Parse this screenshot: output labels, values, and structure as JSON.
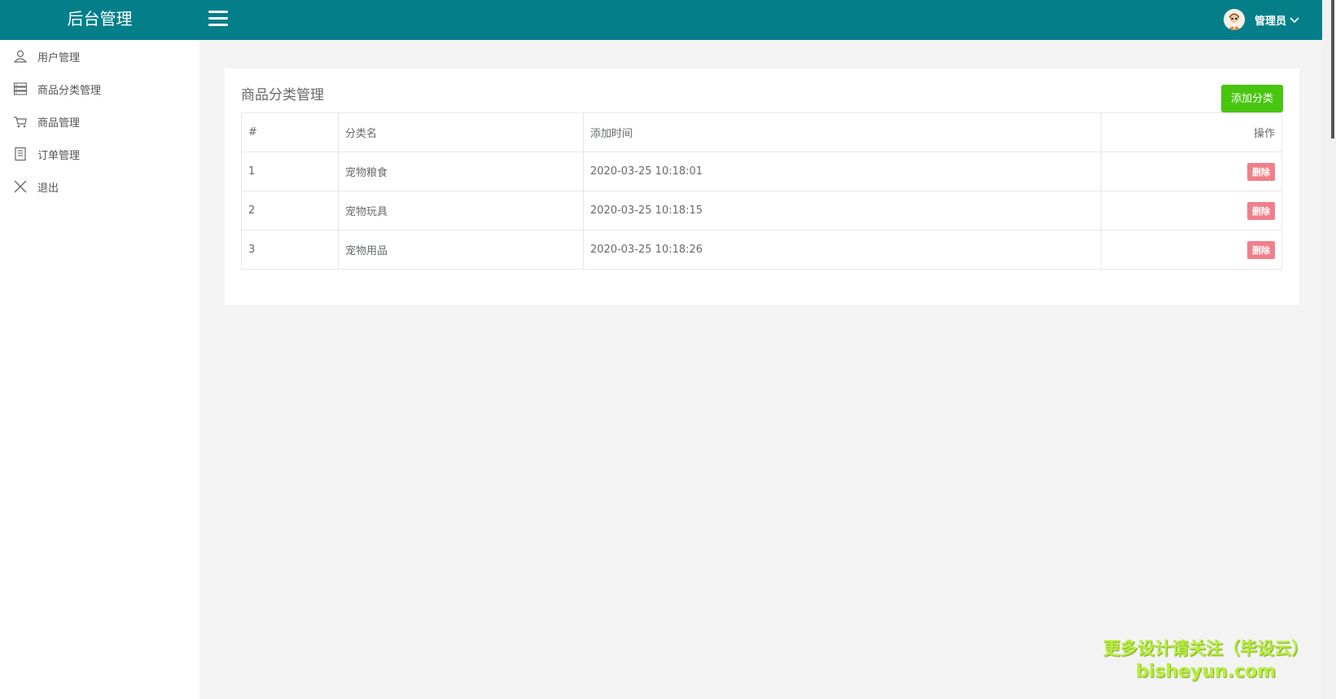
{
  "header": {
    "brand": "后台管理",
    "user_name": "管理员"
  },
  "sidebar": {
    "items": [
      {
        "label": "用户管理",
        "icon": "user-icon"
      },
      {
        "label": "商品分类管理",
        "icon": "list-icon"
      },
      {
        "label": "商品管理",
        "icon": "cart-icon"
      },
      {
        "label": "订单管理",
        "icon": "document-icon"
      },
      {
        "label": "退出",
        "icon": "close-icon"
      }
    ]
  },
  "main": {
    "title": "商品分类管理",
    "add_button": "添加分类",
    "table": {
      "headers": [
        "#",
        "分类名",
        "添加时间",
        "操作"
      ],
      "rows": [
        {
          "idx": "1",
          "name": "宠物粮食",
          "time": "2020-03-25 10:18:01",
          "action": "删除"
        },
        {
          "idx": "2",
          "name": "宠物玩具",
          "time": "2020-03-25 10:18:15",
          "action": "删除"
        },
        {
          "idx": "3",
          "name": "宠物用品",
          "time": "2020-03-25 10:18:26",
          "action": "删除"
        }
      ]
    }
  },
  "watermark": {
    "line1": "更多设计请关注（毕设云）",
    "line2": "bisheyun.com"
  },
  "colors": {
    "header_bg": "#047f8a",
    "add_button_bg": "#48c60f",
    "delete_button_bg": "#ed5565",
    "watermark": "#b7f03c"
  }
}
